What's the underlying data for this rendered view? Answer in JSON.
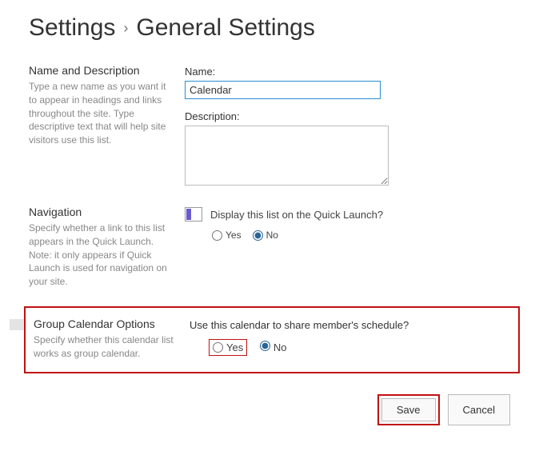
{
  "breadcrumb": {
    "parent": "Settings",
    "current": "General Settings"
  },
  "sections": {
    "nameDesc": {
      "heading": "Name and Description",
      "help": "Type a new name as you want it to appear in headings and links throughout the site. Type descriptive text that will help site visitors use this list.",
      "nameLabel": "Name:",
      "nameValue": "Calendar",
      "descLabel": "Description:",
      "descValue": ""
    },
    "nav": {
      "heading": "Navigation",
      "help": "Specify whether a link to this list appears in the Quick Launch. Note: it only appears if Quick Launch is used for navigation on your site.",
      "question": "Display this list on the Quick Launch?",
      "yes": "Yes",
      "no": "No",
      "selected": "No"
    },
    "groupCal": {
      "heading": "Group Calendar Options",
      "help": "Specify whether this calendar list works as group calendar.",
      "question": "Use this calendar to share member's schedule?",
      "yes": "Yes",
      "no": "No",
      "selected": "No"
    }
  },
  "buttons": {
    "save": "Save",
    "cancel": "Cancel"
  }
}
